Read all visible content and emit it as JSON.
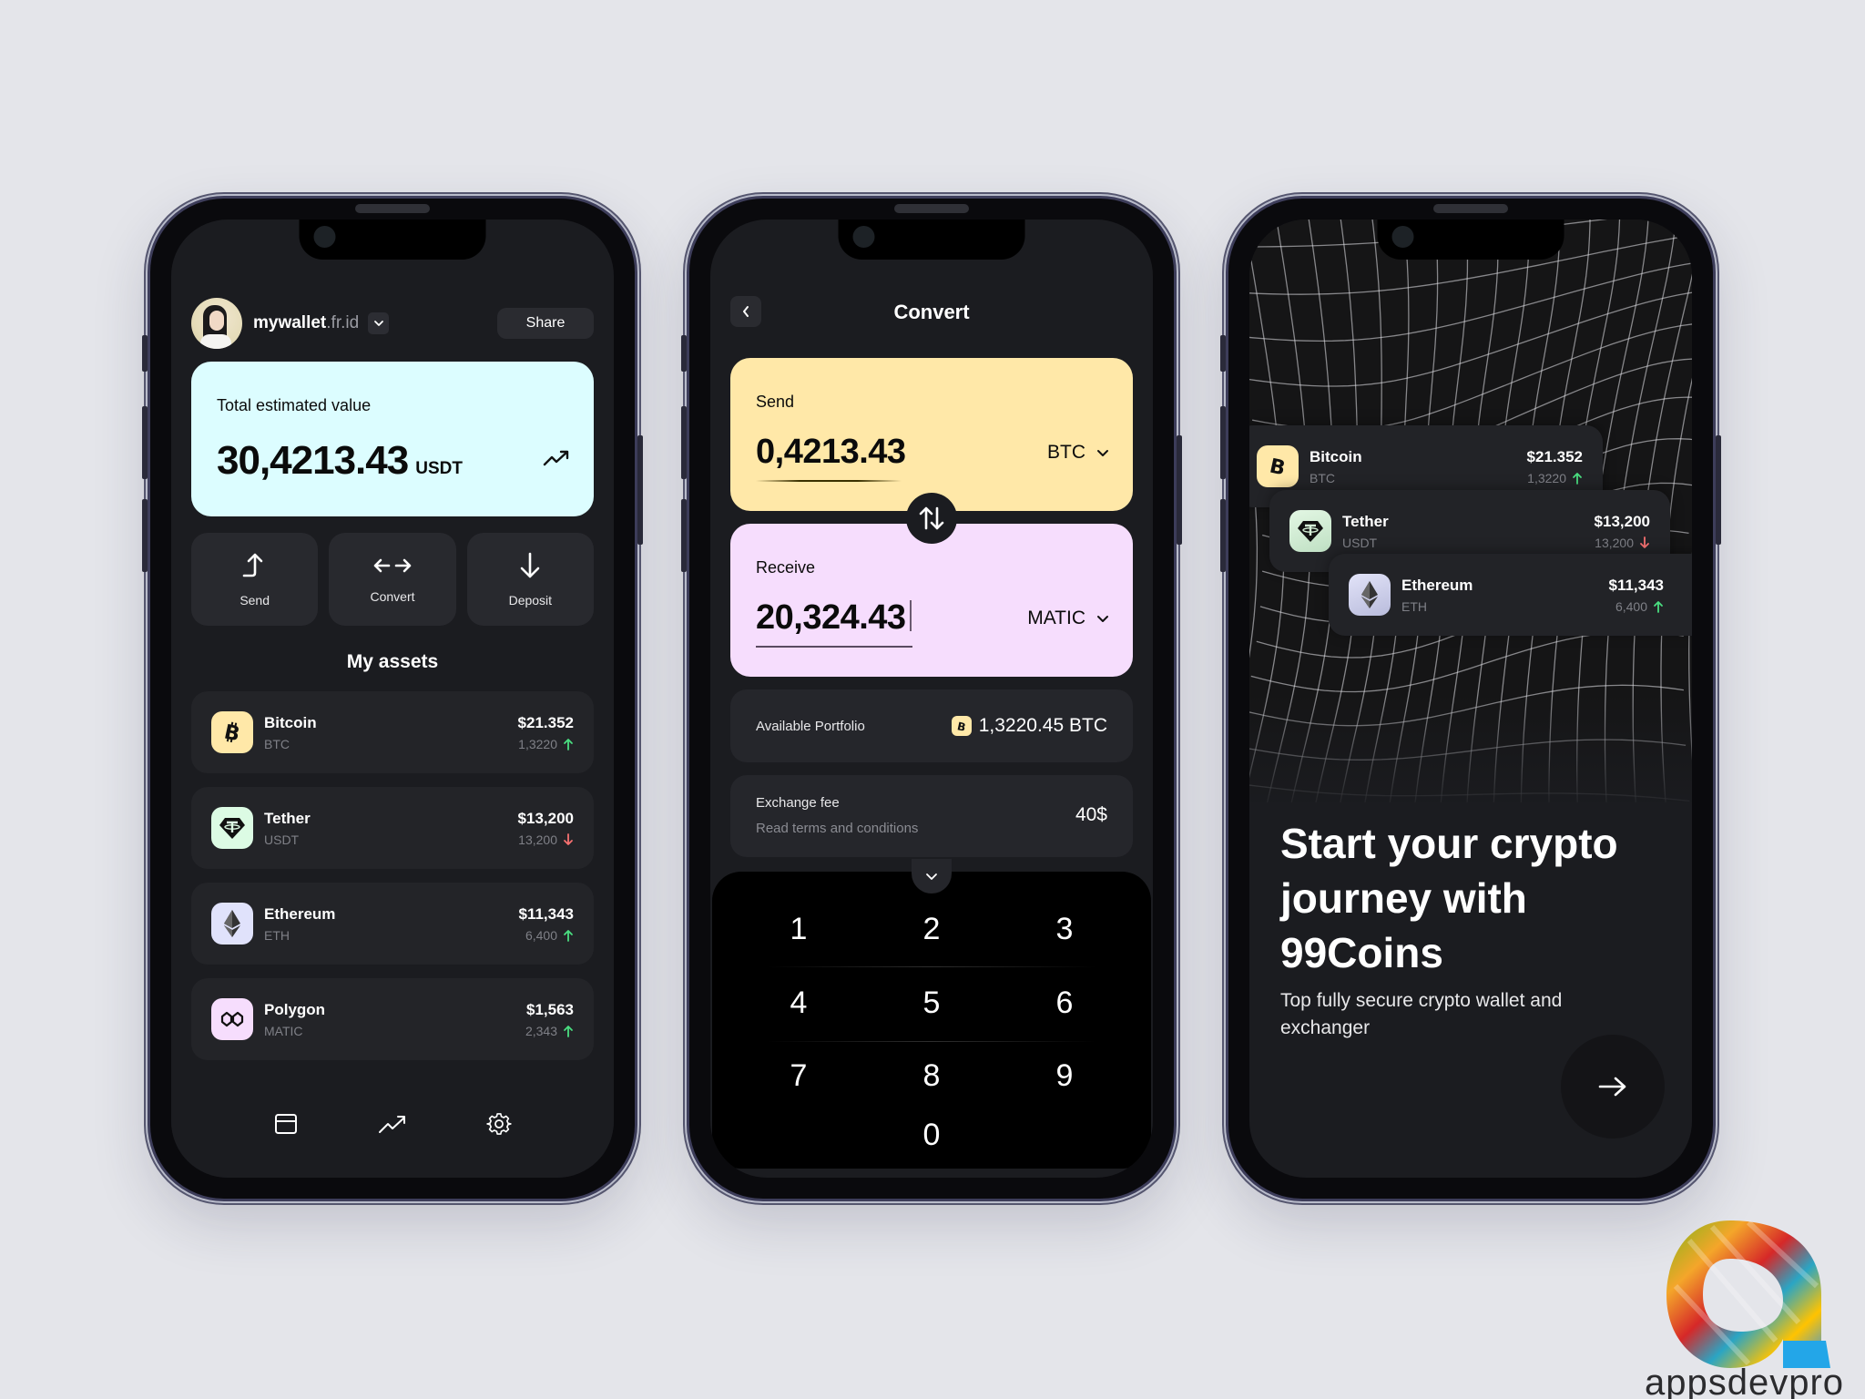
{
  "colors": {
    "background": "#e4e5ea",
    "screen": "#1b1c20",
    "card": "#232428",
    "total_card": "#dcfdff",
    "send_card": "#ffe8a8",
    "receive_card": "#f6ddfd",
    "up": "#4ade80",
    "down": "#f87171"
  },
  "wallet": {
    "username": "mywallet",
    "domain": ".fr.id",
    "share_label": "Share",
    "total_label": "Total estimated value",
    "total_value": "30,4213.43",
    "total_unit": "USDT",
    "actions": [
      {
        "label": "Send",
        "icon": "send-icon"
      },
      {
        "label": "Convert",
        "icon": "convert-icon"
      },
      {
        "label": "Deposit",
        "icon": "deposit-icon"
      }
    ],
    "assets_title": "My assets",
    "assets": [
      {
        "name": "Bitcoin",
        "ticker": "BTC",
        "usd": "$21.352",
        "qty": "1,3220",
        "trend": "up",
        "icon": "bitcoin-icon"
      },
      {
        "name": "Tether",
        "ticker": "USDT",
        "usd": "$13,200",
        "qty": "13,200",
        "trend": "down",
        "icon": "tether-icon"
      },
      {
        "name": "Ethereum",
        "ticker": "ETH",
        "usd": "$11,343",
        "qty": "6,400",
        "trend": "up",
        "icon": "ethereum-icon"
      },
      {
        "name": "Polygon",
        "ticker": "MATIC",
        "usd": "$1,563",
        "qty": "2,343",
        "trend": "up",
        "icon": "polygon-icon"
      }
    ],
    "tabs": [
      {
        "name": "wallet",
        "icon": "wallet-icon"
      },
      {
        "name": "market",
        "icon": "trend-up-icon"
      },
      {
        "name": "settings",
        "icon": "gear-icon"
      }
    ]
  },
  "convert": {
    "title": "Convert",
    "send_label": "Send",
    "send_amount": "0,4213.43",
    "send_currency": "BTC",
    "receive_label": "Receive",
    "receive_amount": "20,324.43",
    "receive_currency": "MATIC",
    "portfolio_label": "Available Portfolio",
    "portfolio_value": "1,3220.45 BTC",
    "fee_label": "Exchange fee",
    "fee_link": "Read terms and conditions",
    "fee_value": "40$",
    "keypad": [
      "1",
      "2",
      "3",
      "4",
      "5",
      "6",
      "7",
      "8",
      "9",
      "0"
    ]
  },
  "onboarding": {
    "cards": [
      {
        "name": "Bitcoin",
        "ticker": "BTC",
        "usd": "$21.352",
        "qty": "1,3220",
        "trend": "up"
      },
      {
        "name": "Tether",
        "ticker": "USDT",
        "usd": "$13,200",
        "qty": "13,200",
        "trend": "down"
      },
      {
        "name": "Ethereum",
        "ticker": "ETH",
        "usd": "$11,343",
        "qty": "6,400",
        "trend": "up"
      }
    ],
    "title": "Start your crypto journey with 99Coins",
    "subtitle": "Top fully secure crypto wallet and exchanger",
    "next_icon": "arrow-right-icon"
  },
  "brand": {
    "name": "appsdevpro"
  }
}
